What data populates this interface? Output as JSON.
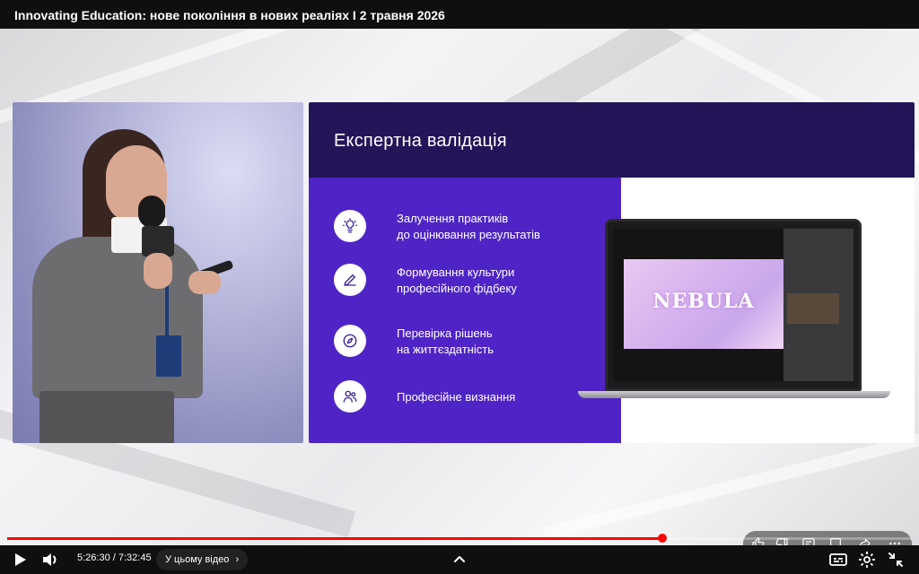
{
  "window": {
    "title": "Innovating Education: нове покоління в нових реаліях І 2 травня 2026"
  },
  "slide": {
    "title": "Експертна валідація",
    "items": [
      {
        "icon": "lightbulb-icon",
        "text": "Залучення практиків\nдо оцінювання результатів"
      },
      {
        "icon": "pencil-icon",
        "text": "Формування культури\nпрофесійного фідбеку"
      },
      {
        "icon": "compass-icon",
        "text": "Перевірка рішень\nна життєздатність"
      },
      {
        "icon": "users-icon",
        "text": "Професійне визнання"
      }
    ],
    "laptop_screen_text": "NEBULA",
    "colors": {
      "header": "#241558",
      "panel": "#4f24c6"
    }
  },
  "overlay_actions": [
    "like-icon",
    "dislike-icon",
    "comment-icon",
    "live-chat-icon",
    "share-icon",
    "more-icon"
  ],
  "player": {
    "current_time": "5:26:30",
    "duration": "7:32:45",
    "time_display": "5:26:30 / 7:32:45",
    "chapter_label": "У цьому відео",
    "progress_fraction": 0.724,
    "accent": "#ff0000"
  }
}
